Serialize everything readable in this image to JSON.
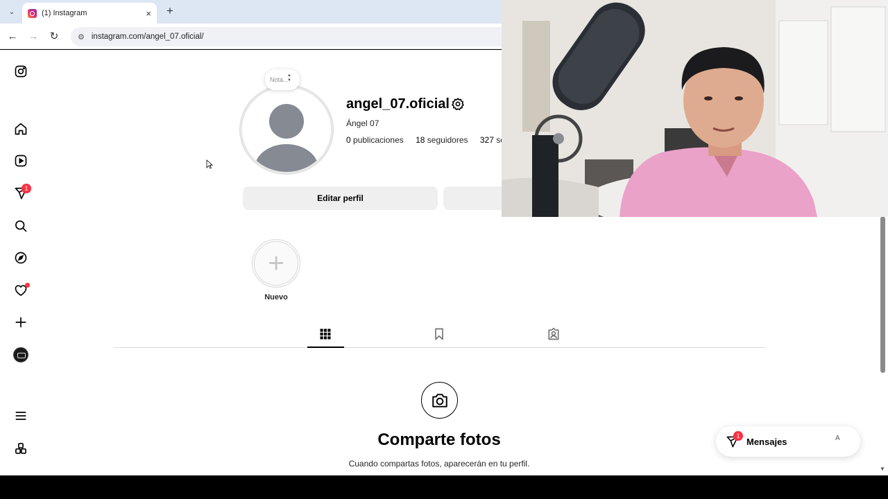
{
  "browser": {
    "tab_title": "(1) Instagram",
    "tab_close": "×",
    "new_tab": "+",
    "tab_dropdown": "⌄",
    "back": "←",
    "forward": "→",
    "reload": "↻",
    "site_info": "⚙",
    "url": "instagram.com/angel_07.oficial/"
  },
  "sidebar": {
    "notification_count": "1"
  },
  "profile": {
    "note_placeholder": "Nota...",
    "username": "angel_07.oficial",
    "full_name": "Ángel 07",
    "posts_count": "0",
    "posts_label": "publicaciones",
    "followers_count": "18",
    "followers_label": "seguidores",
    "following_count": "327",
    "following_label": "seguidos",
    "edit_button": "Editar perfil"
  },
  "highlights": {
    "new_label": "Nuevo"
  },
  "empty_state": {
    "title": "Comparte fotos",
    "subtitle": "Cuando compartas fotos, aparecerán en tu perfil."
  },
  "messages": {
    "label": "Mensajes",
    "badge": "1",
    "alt_text": "A"
  },
  "colors": {
    "badge": "#ff3040",
    "tabbar": "#dde6f3",
    "button_bg": "#efefef"
  }
}
